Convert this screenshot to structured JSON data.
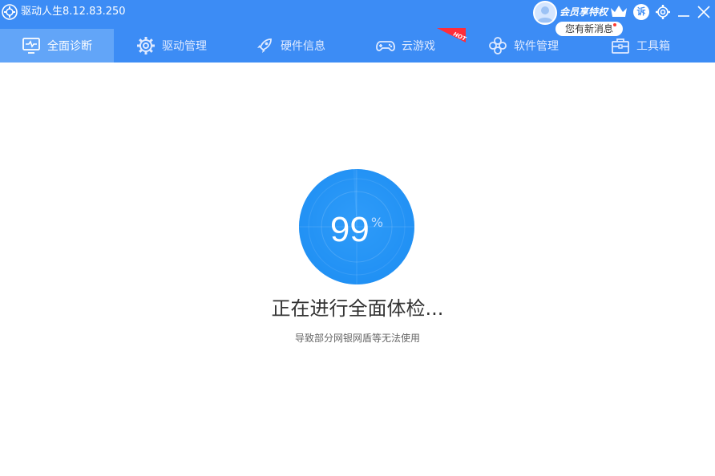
{
  "app": {
    "title": "驱动人生8.12.83.250"
  },
  "header": {
    "vip_label": "会员享特权",
    "message_label": "您有新消息",
    "service_label": "诉"
  },
  "tabs": [
    {
      "label": "全面诊断",
      "icon": "monitor-pulse-icon",
      "active": true
    },
    {
      "label": "驱动管理",
      "icon": "gear-icon"
    },
    {
      "label": "硬件信息",
      "icon": "rocket-icon"
    },
    {
      "label": "云游戏",
      "icon": "gamepad-icon",
      "badge": "HOT"
    },
    {
      "label": "软件管理",
      "icon": "flower-icon"
    },
    {
      "label": "工具箱",
      "icon": "toolbox-icon"
    }
  ],
  "progress": {
    "value": "99",
    "unit": "%",
    "fraction": 0.99
  },
  "status": {
    "title": "正在进行全面体检...",
    "subtitle": "导致部分网银网盾等无法使用"
  },
  "colors": {
    "accent": "#3c8cf5",
    "active_tab": "#62a5f8",
    "progress": "#1e8ff4",
    "hot": "#ff2d3a"
  }
}
